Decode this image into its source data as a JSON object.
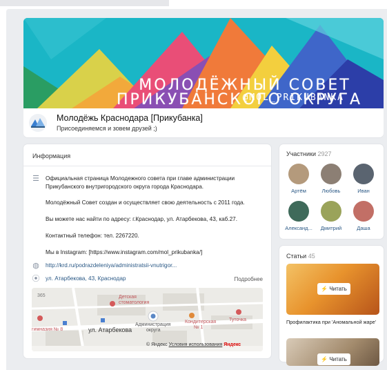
{
  "cover": {
    "line1": "МОЛОДЁЖНЫЙ СОВЕТ",
    "line2": "ПРИКУБАНСКОГО ОКРУГА",
    "tag": "@MOL_PRIKUBANKA",
    "bg": "#1ab6c6"
  },
  "group": {
    "name": "Молодёжь Краснодара [Прикубанка]",
    "status": "Присоединяемся и зовем друзей ;)"
  },
  "info": {
    "title": "Информация",
    "description": [
      "Официальная страница Молодежного совета при главе администрации",
      "Прикубанского внутригородского округа города Краснодара.",
      "Молодёжный Совет создан и осуществляет свою деятельность с 2011 года.",
      "Вы можете нас найти по адресу: г.Краснодар, ул. Атарбекова, 43, каб.27.",
      "Контактный телефон: тел. 2267220.",
      "Мы в Instagram: [https://www.instagram.com/mol_prikubanka/]"
    ],
    "website": "http://krd.ru/podrazdeleniya/administratsii-vnutrigor...",
    "address": "ул. Атарбекова, 43, Краснодар",
    "more": "Подробнее"
  },
  "map": {
    "labels": {
      "zoo": "Детская",
      "zoo2": "стоматология",
      "admin1": "Администрация",
      "admin2": "округа",
      "kond1": "Кондитерская",
      "kond2": "№ 1",
      "tuto": "Туточка",
      "school": "гимназия № 8",
      "num": "365"
    },
    "street": "ул. Атарбекова",
    "footer_logo": "© Яндекс",
    "footer_terms": "Условия использования",
    "footer_brand": "Яндекс"
  },
  "members": {
    "title": "Участники",
    "count": "2927",
    "people": [
      {
        "name": "Артём",
        "color": "#b49a7c"
      },
      {
        "name": "Любовь",
        "color": "#8c7f74"
      },
      {
        "name": "Иван",
        "color": "#5a6470"
      },
      {
        "name": "Александ...",
        "color": "#3f6a5a"
      },
      {
        "name": "Дмитрий",
        "color": "#9aa35a"
      },
      {
        "name": "Даша",
        "color": "#c26f66"
      }
    ]
  },
  "articles": {
    "title": "Статьи",
    "count": "45",
    "read_label": "Читать",
    "first_title": "Профилактика при 'Аномальной жаре'",
    "read_label2": "Читать"
  }
}
